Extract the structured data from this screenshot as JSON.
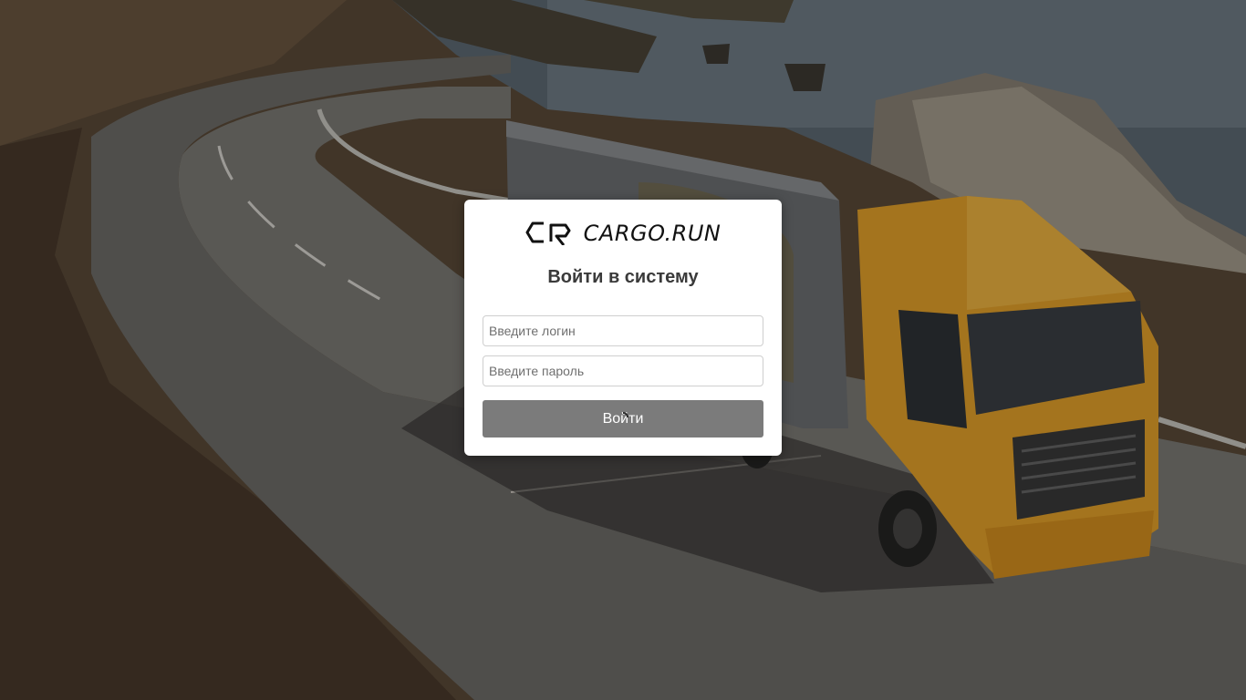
{
  "logo": {
    "text": "CARGO.RUN",
    "icon": "cargo-run-logo-icon"
  },
  "form": {
    "title": "Войти в систему",
    "login_placeholder": "Введите логин",
    "login_value": "",
    "password_placeholder": "Введите пароль",
    "password_value": "",
    "submit_label": "Войти",
    "submit_state": "loading"
  },
  "colors": {
    "card_background": "#ffffff",
    "submit_button": "#7b7b7b",
    "title_text": "#3a3a3a",
    "field_border": "#cfcfcf",
    "truck_cab": "#e3a12a"
  },
  "background": {
    "icon": "truck-on-coastal-road-photo"
  }
}
